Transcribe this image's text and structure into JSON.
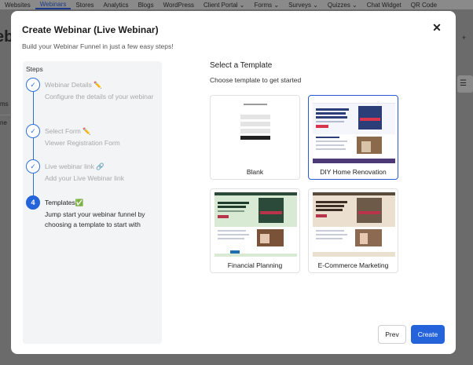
{
  "topnav": {
    "items": [
      "Websites",
      "Webinars",
      "Stores",
      "Analytics",
      "Blogs",
      "WordPress",
      "Client Portal ⌄",
      "Forms ⌄",
      "Surveys ⌄",
      "Quizzes ⌄",
      "Chat Widget",
      "QR Code"
    ],
    "active_index": 1
  },
  "background": {
    "page_fragment": "eb",
    "left_fragment_1": "ms",
    "left_fragment_2": "ne"
  },
  "modal": {
    "title": "Create Webinar (Live Webinar)",
    "subtitle": "Build your Webinar Funnel in just a few easy steps!",
    "close_symbol": "✕"
  },
  "steps": {
    "heading": "Steps",
    "items": [
      {
        "marker": "✓",
        "title": "Webinar Details ✏️",
        "desc": "Configure the details of your webinar",
        "state": "done"
      },
      {
        "marker": "✓",
        "title": "Select Form ✏️",
        "desc": "Viewer Registration Form",
        "state": "done"
      },
      {
        "marker": "✓",
        "title": "Live webinar link 🔗",
        "desc": "Add your Live Webinar link",
        "state": "done"
      },
      {
        "marker": "4",
        "title": "Templates✅",
        "desc": "Jump start your webinar funnel by choosing a template to start with",
        "state": "active"
      }
    ]
  },
  "templates": {
    "heading": "Select a Template",
    "subheading": "Choose template to get started",
    "cards": [
      {
        "label": "Blank",
        "selected": false
      },
      {
        "label": "DIY Home Renovation",
        "selected": true
      },
      {
        "label": "Financial Planning",
        "selected": false
      },
      {
        "label": "E-Commerce Marketing",
        "selected": false
      }
    ]
  },
  "buttons": {
    "prev": "Prev",
    "create": "Create"
  },
  "colors": {
    "primary": "#2463d9",
    "overlay": "#6b6b6b",
    "steps_panel": "#f3f4f6"
  }
}
